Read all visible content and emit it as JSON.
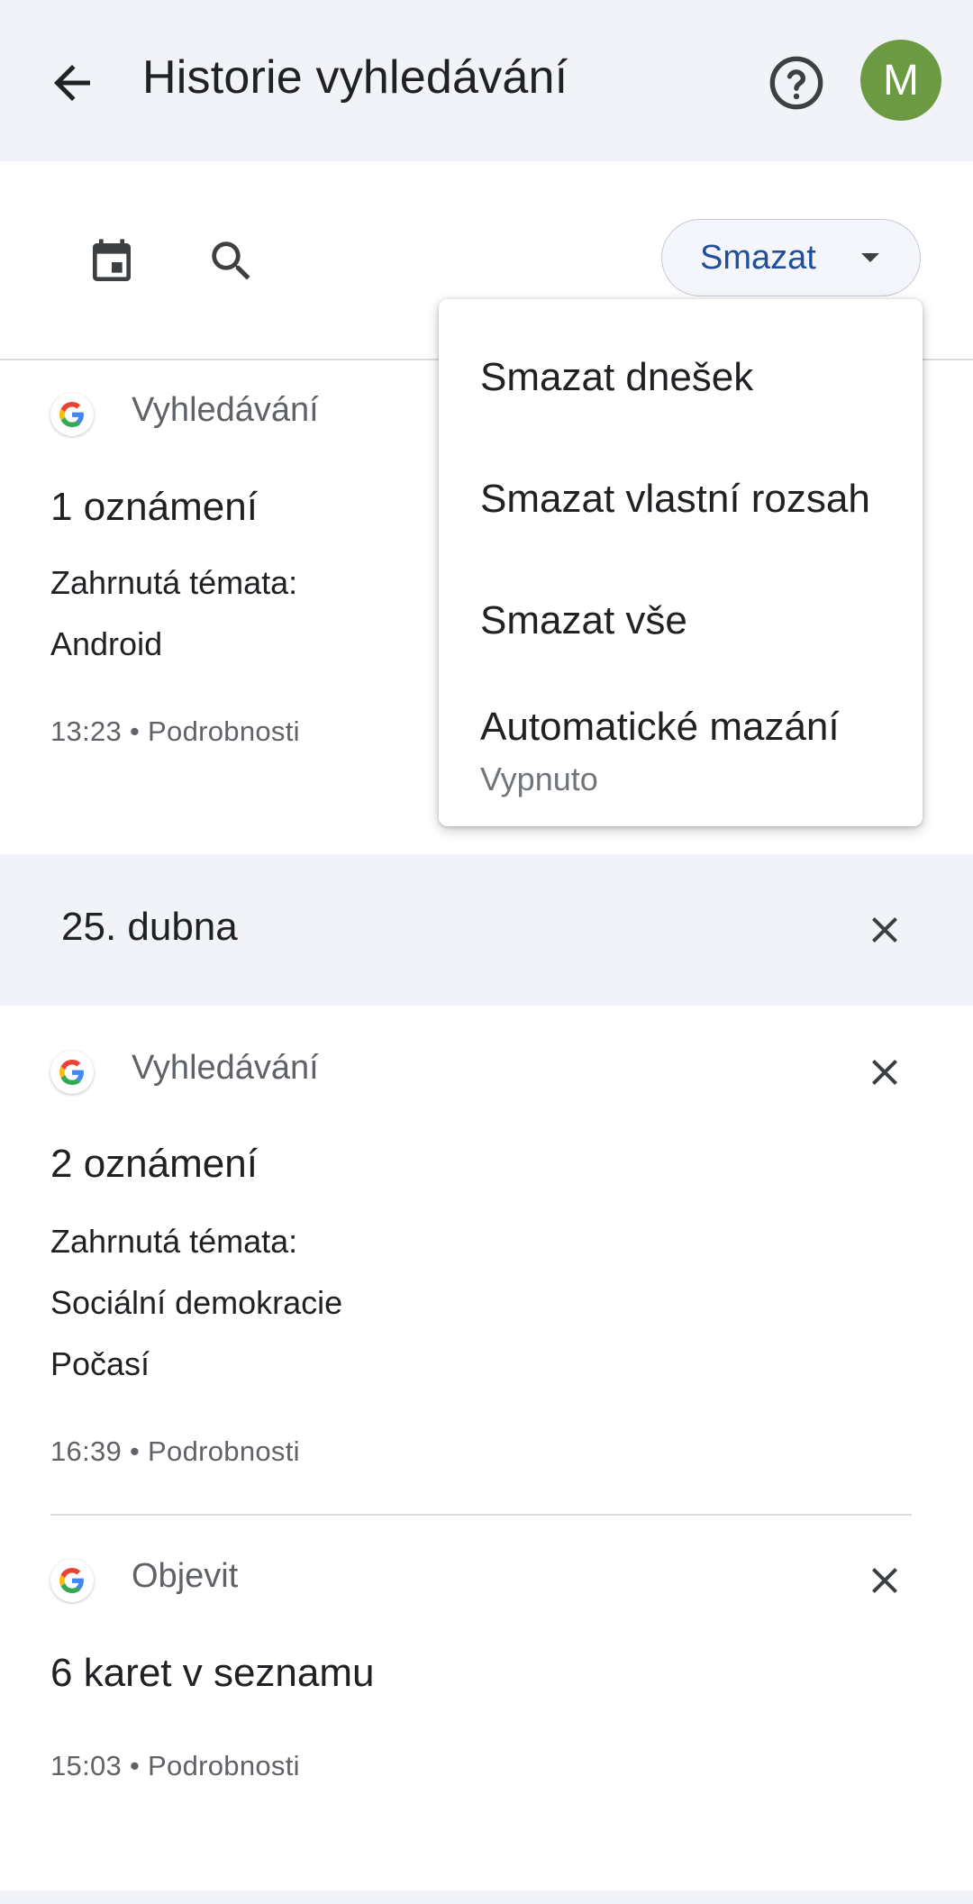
{
  "header": {
    "title": "Historie vyhledávání",
    "avatar_letter": "M",
    "avatar_color": "#6b9a43"
  },
  "toolbar": {
    "delete_label": "Smazat"
  },
  "menu": {
    "items": [
      {
        "label": "Smazat dnešek"
      },
      {
        "label": "Smazat vlastní rozsah"
      },
      {
        "label": "Smazat vše"
      },
      {
        "label": "Automatické mazání",
        "sublabel": "Vypnuto"
      }
    ]
  },
  "today": {
    "items": [
      {
        "service": "Vyhledávání",
        "headline": "1 oznámení",
        "lines": [
          "Zahrnutá témata:",
          "Android"
        ],
        "meta": "13:23 • Podrobnosti"
      }
    ]
  },
  "day2": {
    "date": "25. dubna",
    "items": [
      {
        "service": "Vyhledávání",
        "headline": "2 oznámení",
        "lines": [
          "Zahrnutá témata:",
          "Sociální demokracie",
          "Počasí"
        ],
        "meta": "16:39 • Podrobnosti"
      },
      {
        "service": "Objevit",
        "headline": "6 karet v seznamu",
        "meta": "15:03 • Podrobnosti"
      }
    ]
  },
  "colors": {
    "header_bg": "#f1f3f8",
    "accent_text": "#1f4e9b"
  }
}
